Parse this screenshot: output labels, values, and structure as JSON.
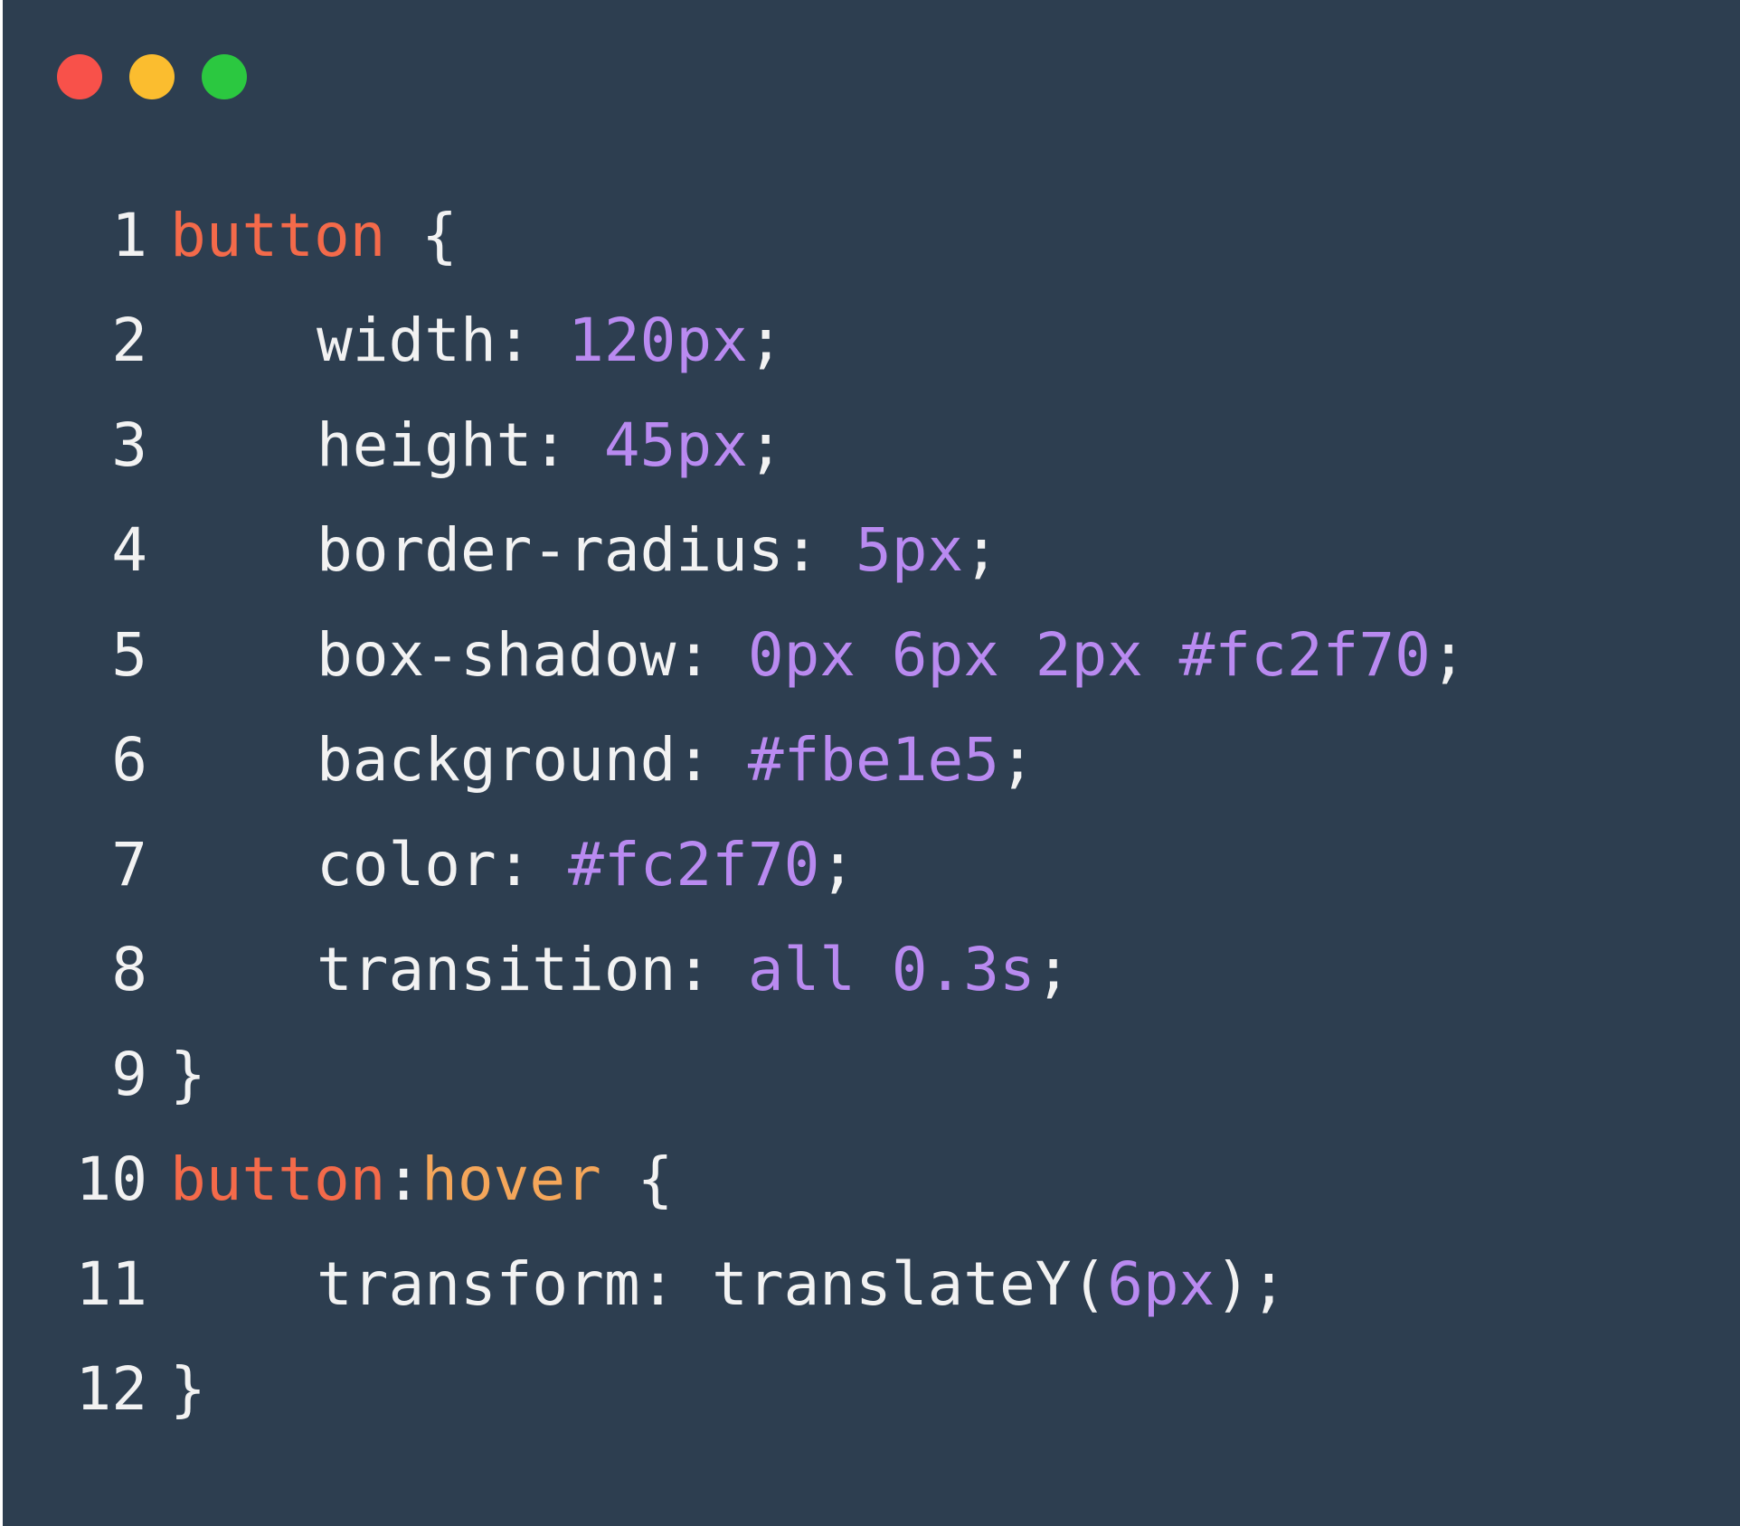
{
  "colors": {
    "background": "#2d3e50",
    "default_text": "#f2f2f2",
    "selector": "#f46a4a",
    "pseudo_class": "#f4a65a",
    "value": "#b98af0",
    "traffic_red": "#f8514a",
    "traffic_yellow": "#fbbd2f",
    "traffic_green": "#2bc840"
  },
  "window": {
    "controls": [
      "close-dot",
      "minimize-dot",
      "maximize-dot"
    ]
  },
  "code": {
    "lines": [
      {
        "num": "1",
        "tokens": [
          {
            "t": "button",
            "c": "sel"
          },
          {
            "t": " {",
            "c": "def"
          }
        ]
      },
      {
        "num": "2",
        "indent": true,
        "tokens": [
          {
            "t": "width: ",
            "c": "def"
          },
          {
            "t": "120px",
            "c": "val"
          },
          {
            "t": ";",
            "c": "def"
          }
        ]
      },
      {
        "num": "3",
        "indent": true,
        "tokens": [
          {
            "t": "height: ",
            "c": "def"
          },
          {
            "t": "45px",
            "c": "val"
          },
          {
            "t": ";",
            "c": "def"
          }
        ]
      },
      {
        "num": "4",
        "indent": true,
        "tokens": [
          {
            "t": "border-radius: ",
            "c": "def"
          },
          {
            "t": "5px",
            "c": "val"
          },
          {
            "t": ";",
            "c": "def"
          }
        ]
      },
      {
        "num": "5",
        "indent": true,
        "tokens": [
          {
            "t": "box-shadow: ",
            "c": "def"
          },
          {
            "t": "0px 6px 2px #fc2f70",
            "c": "val"
          },
          {
            "t": ";",
            "c": "def"
          }
        ]
      },
      {
        "num": "6",
        "indent": true,
        "tokens": [
          {
            "t": "background: ",
            "c": "def"
          },
          {
            "t": "#fbe1e5",
            "c": "val"
          },
          {
            "t": ";",
            "c": "def"
          }
        ]
      },
      {
        "num": "7",
        "indent": true,
        "tokens": [
          {
            "t": "color: ",
            "c": "def"
          },
          {
            "t": "#fc2f70",
            "c": "val"
          },
          {
            "t": ";",
            "c": "def"
          }
        ]
      },
      {
        "num": "8",
        "indent": true,
        "tokens": [
          {
            "t": "transition: ",
            "c": "def"
          },
          {
            "t": "all 0.3s",
            "c": "val"
          },
          {
            "t": ";",
            "c": "def"
          }
        ]
      },
      {
        "num": "9",
        "tokens": [
          {
            "t": "}",
            "c": "def"
          }
        ]
      },
      {
        "num": "10",
        "tokens": [
          {
            "t": "button",
            "c": "sel"
          },
          {
            "t": ":",
            "c": "def"
          },
          {
            "t": "hover",
            "c": "pseudo"
          },
          {
            "t": " {",
            "c": "def"
          }
        ]
      },
      {
        "num": "11",
        "indent": true,
        "tokens": [
          {
            "t": "transform: translateY(",
            "c": "def"
          },
          {
            "t": "6px",
            "c": "val"
          },
          {
            "t": ");",
            "c": "def"
          }
        ]
      },
      {
        "num": "12",
        "tokens": [
          {
            "t": "}",
            "c": "def"
          }
        ]
      }
    ]
  }
}
